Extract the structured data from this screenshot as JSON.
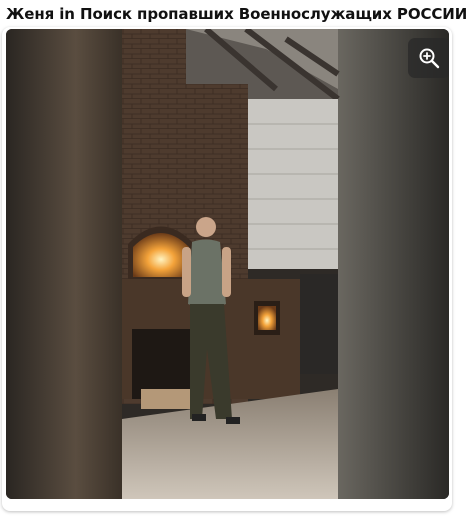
{
  "post": {
    "title": "Женя in Поиск пропавших Военнослужащих РОССИИ",
    "flag_colors": [
      "#ffffff",
      "#1c57c8",
      "#d52b1e"
    ]
  },
  "media": {
    "type": "video-frame",
    "zoom_icon": "zoom-in-icon"
  }
}
